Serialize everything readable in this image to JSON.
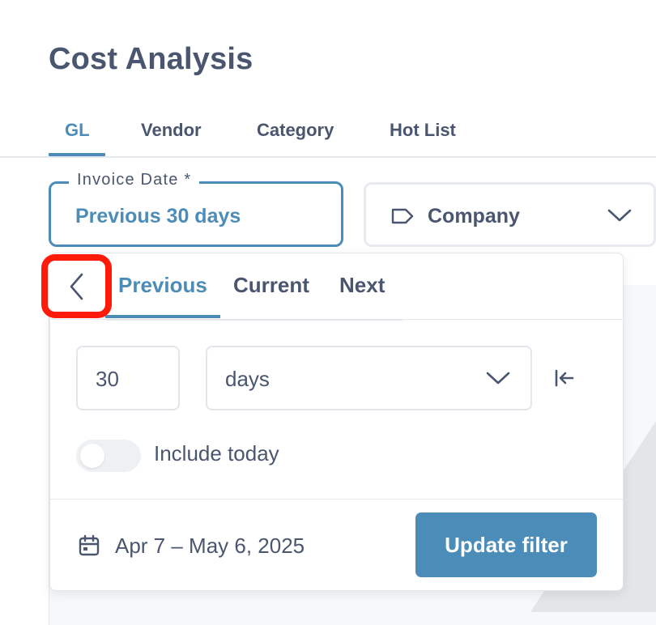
{
  "page": {
    "title": "Cost Analysis"
  },
  "tabs": [
    {
      "label": "GL",
      "active": true
    },
    {
      "label": "Vendor",
      "active": false
    },
    {
      "label": "Category",
      "active": false
    },
    {
      "label": "Hot List",
      "active": false
    }
  ],
  "filters": {
    "invoice_date": {
      "label": "Invoice Date *",
      "value": "Previous 30 days"
    },
    "company": {
      "label": "Company",
      "icon": "tag-icon"
    }
  },
  "date_popover": {
    "back_icon": "chevron-left-icon",
    "tabs": [
      {
        "label": "Previous",
        "active": true
      },
      {
        "label": "Current",
        "active": false
      },
      {
        "label": "Next",
        "active": false
      }
    ],
    "amount": "30",
    "unit": "days",
    "include_today_label": "Include today",
    "include_today": false,
    "range_text": "Apr 7 – May 6, 2025",
    "update_button": "Update filter"
  },
  "colors": {
    "accent": "#4b8db8",
    "text": "#4a5670",
    "highlight": "#ff1a0a"
  }
}
